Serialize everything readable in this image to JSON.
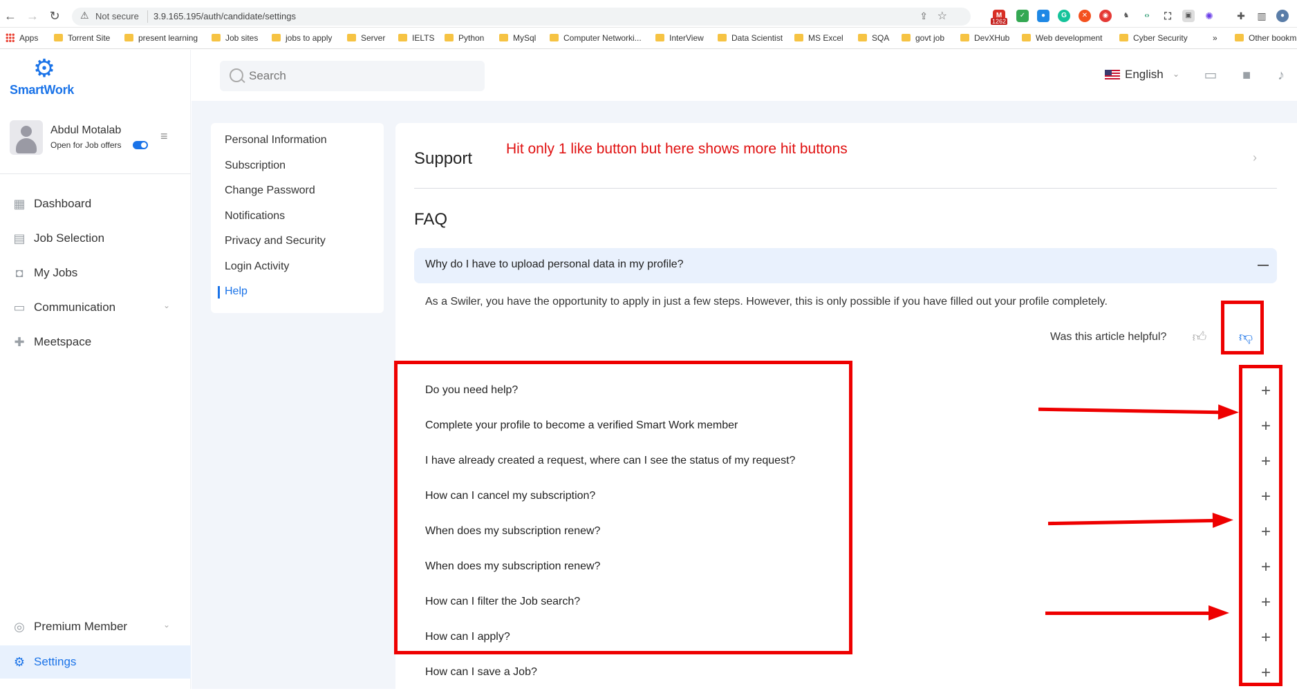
{
  "browser": {
    "security_label": "Not secure",
    "url": "3.9.165.195/auth/candidate/settings",
    "gmail_badge": "1262",
    "bookmarks": [
      "Apps",
      "Torrent Site",
      "present learning",
      "Job sites",
      "jobs to apply",
      "Server",
      "IELTS",
      "Python",
      "MySql",
      "Computer Networki...",
      "InterView",
      "Data Scientist",
      "MS Excel",
      "SQA",
      "govt job",
      "DevXHub",
      "Web development",
      "Cyber Security",
      "»",
      "Other bookm"
    ]
  },
  "app": {
    "brand": "SmartWork",
    "brand_color": "#1a73e8",
    "user": {
      "name": "Abdul Motalab",
      "status": "Open for Job offers"
    },
    "nav": [
      {
        "label": "Dashboard",
        "icon": "dashboard-icon"
      },
      {
        "label": "Job Selection",
        "icon": "briefcase-icon"
      },
      {
        "label": "My Jobs",
        "icon": "jobs-bag-icon"
      },
      {
        "label": "Communication",
        "icon": "chat-icon"
      },
      {
        "label": "Meetspace",
        "icon": "meetspace-icon"
      }
    ],
    "bottom_nav": [
      {
        "label": "Premium Member",
        "icon": "premium-icon"
      },
      {
        "label": "Settings",
        "icon": "settings-gear-icon"
      }
    ],
    "search": {
      "placeholder": "Search"
    },
    "language": "English"
  },
  "settings_nav": [
    "Personal Information",
    "Subscription",
    "Change Password",
    "Notifications",
    "Privacy and Security",
    "Login Activity",
    "Help"
  ],
  "support": {
    "title": "Support",
    "annotation": "Hit only 1 like button but here shows more hit buttons",
    "faq_title": "FAQ",
    "open_question": "Why do I have to upload personal data in my profile?",
    "answer": "As a Swiler, you have the opportunity to apply in just a few steps. However, this is only possible if you have filled out your profile completely.",
    "helpful_prompt": "Was this article helpful?",
    "questions": [
      "Do you need help?",
      "Complete your profile to become a verified Smart Work member",
      "I have already created a request, where can I see the status of my request?",
      "How can I cancel my subscription?",
      "When does my subscription renew?",
      "When does my subscription renew?",
      "How can I filter the Job search?",
      "How can I apply?",
      "How can I save a Job?"
    ]
  }
}
